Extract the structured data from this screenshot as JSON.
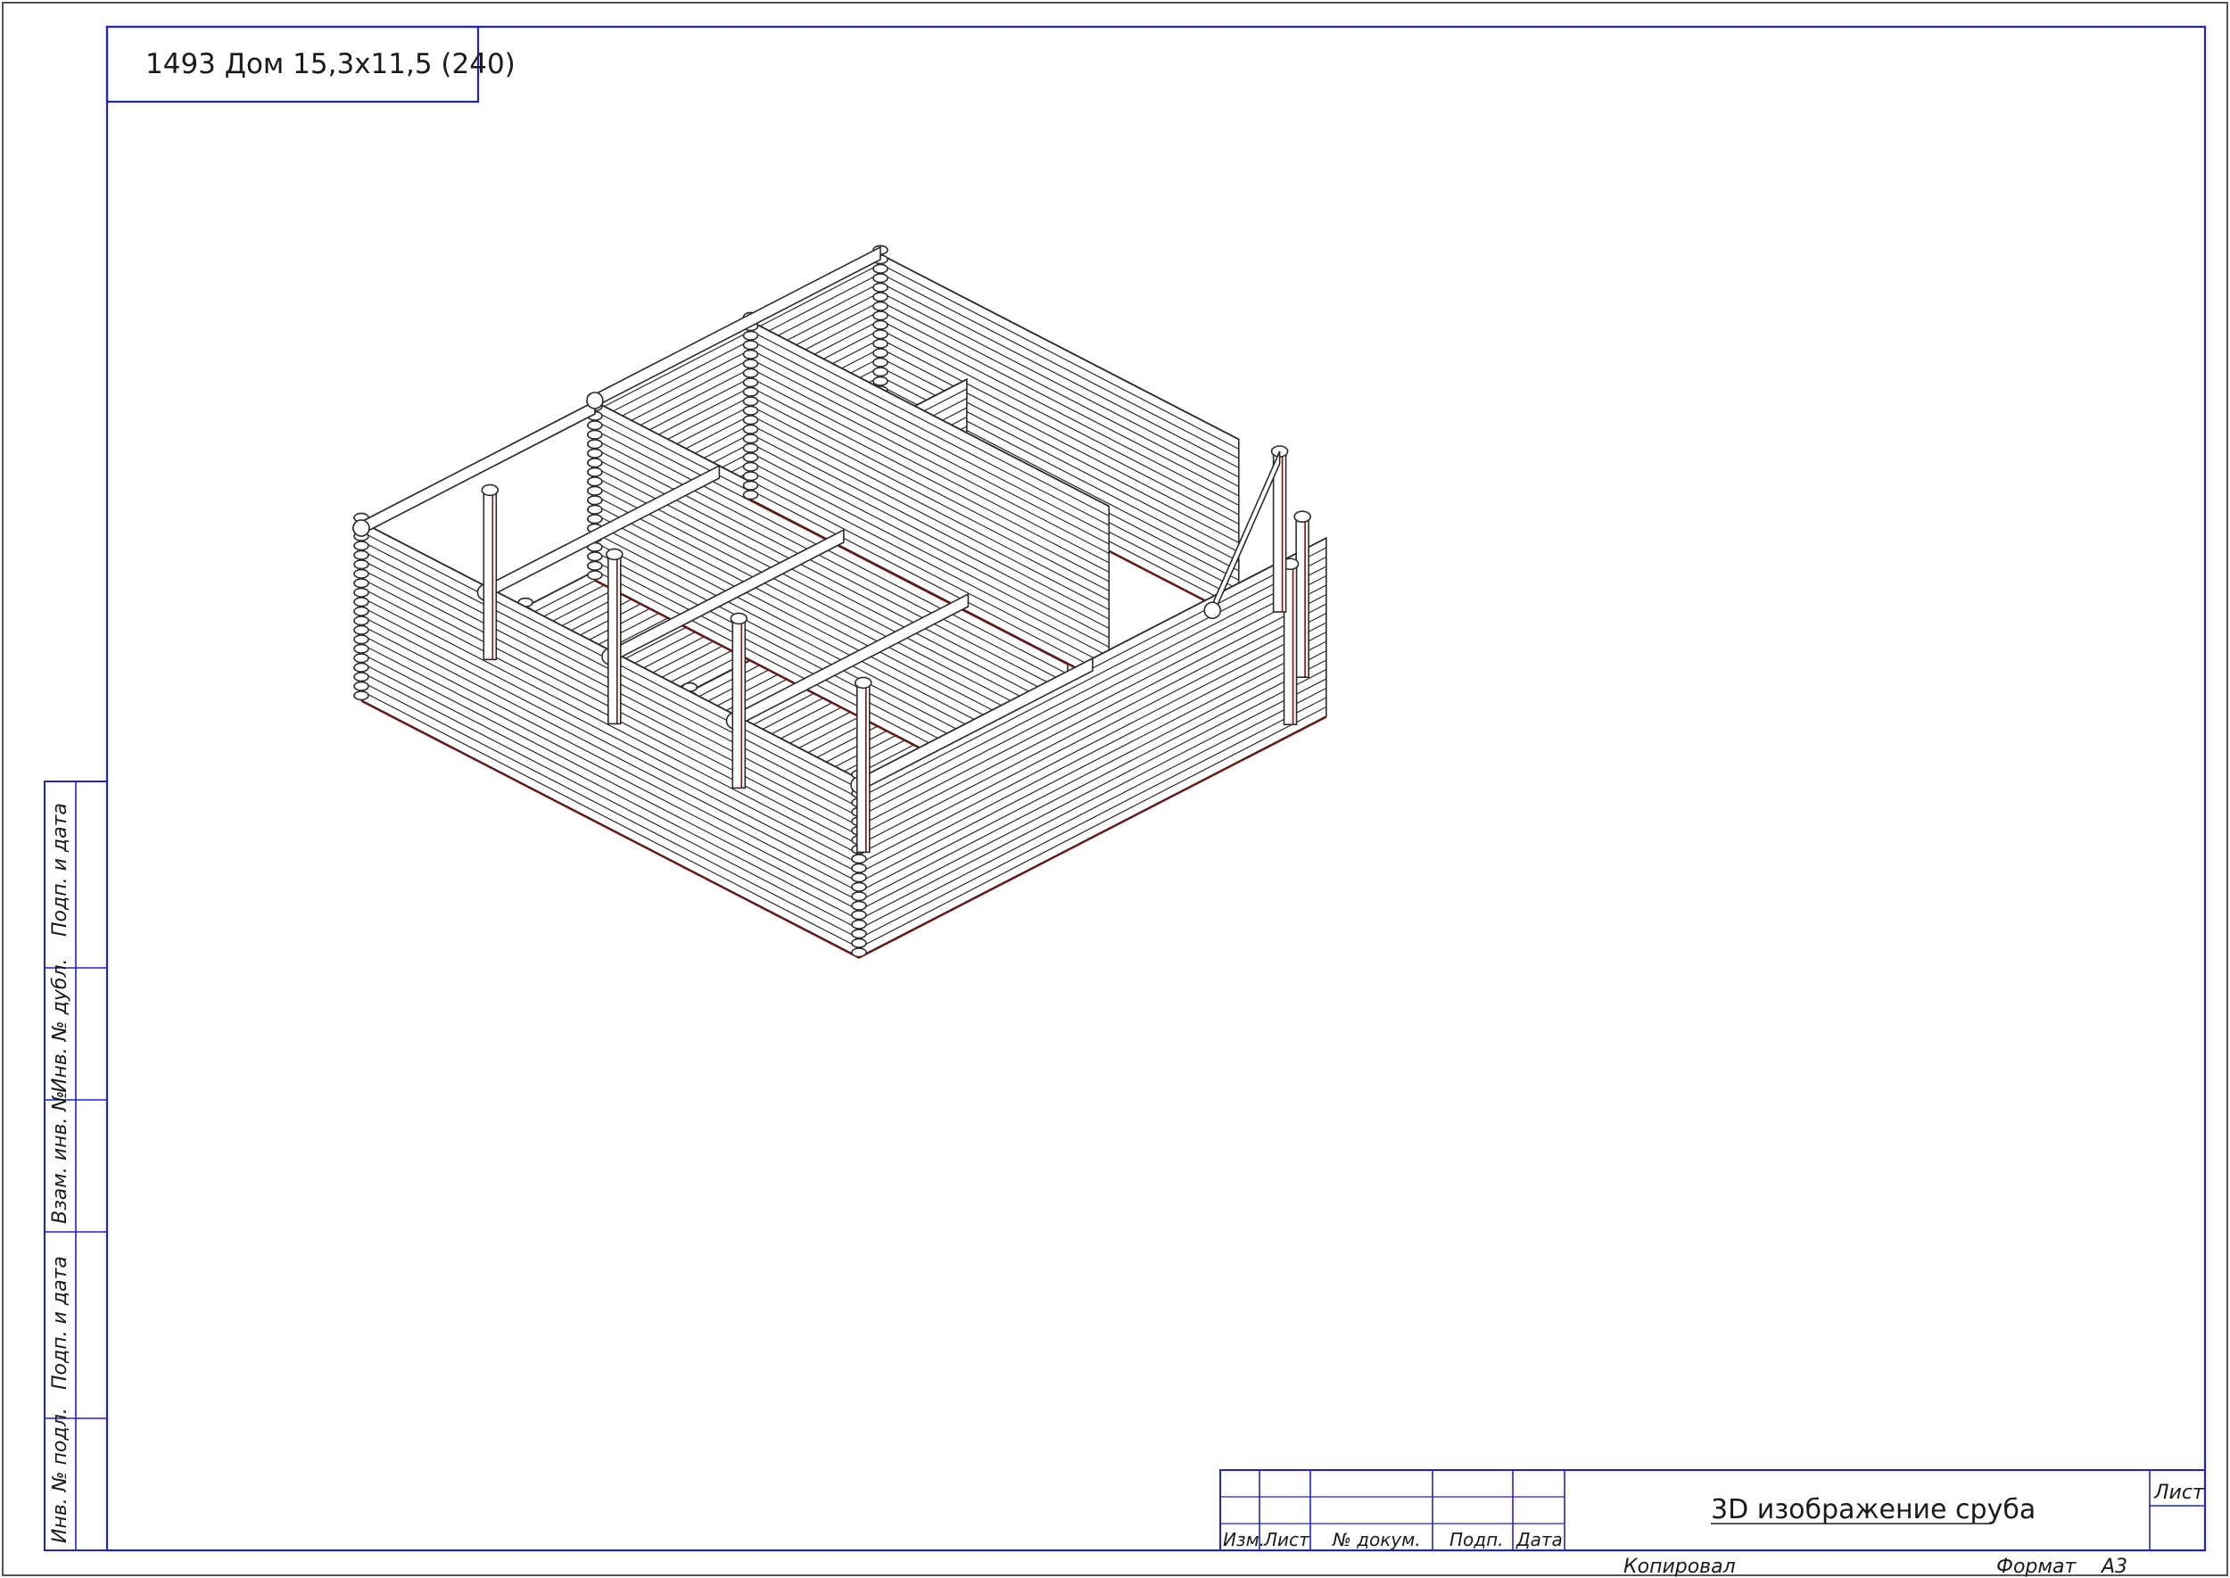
{
  "drawing": {
    "project_title": "1493 Дом 15,3х11,5 (240)",
    "sheet_title": "3D изображение сруба"
  },
  "side_stamp": {
    "cells": [
      "Подп. и дата",
      "Инв. № дубл.",
      "Взам. инв. №",
      "Подп. и дата",
      "Инв. № подл."
    ]
  },
  "title_block": {
    "columns": [
      "Изм.",
      "Лист",
      "№ докум.",
      "Подп.",
      "Дата"
    ],
    "sheet_label": "Лист"
  },
  "footer": {
    "copied_label": "Копировал",
    "format_label": "Формат",
    "format_value": "А3"
  },
  "colors": {
    "frame": "#2222cc",
    "lines": "#2a2a2a",
    "hidden_edges": "#7a1010"
  }
}
